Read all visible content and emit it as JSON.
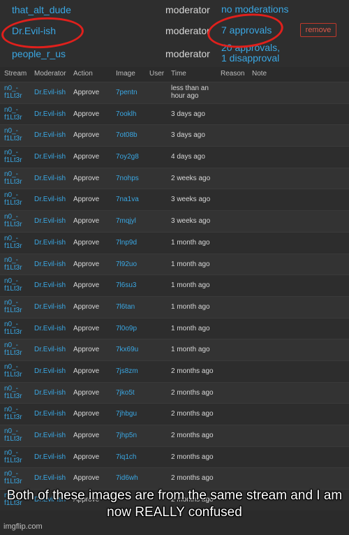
{
  "moderators": [
    {
      "name": "that_alt_dude",
      "role": "moderator",
      "count": "no moderations"
    },
    {
      "name": "Dr.Evil-ish",
      "role": "moderator",
      "count": "7 approvals"
    },
    {
      "name": "people_r_us",
      "role": "moderator",
      "count": "20 approvals,\n1 disapproval"
    }
  ],
  "remove_label": "remove",
  "headers": {
    "stream": "Stream",
    "moderator": "Moderator",
    "action": "Action",
    "image": "Image",
    "user": "User",
    "time": "Time",
    "reason": "Reason",
    "note": "Note"
  },
  "rows": [
    {
      "stream": "n0_-\nf1Lt3r",
      "moderator": "Dr.Evil-ish",
      "action": "Approve",
      "image": "7pentn",
      "time": "less than an\nhour ago"
    },
    {
      "stream": "n0_-\nf1Lt3r",
      "moderator": "Dr.Evil-ish",
      "action": "Approve",
      "image": "7ooklh",
      "time": "3 days ago"
    },
    {
      "stream": "n0_-\nf1Lt3r",
      "moderator": "Dr.Evil-ish",
      "action": "Approve",
      "image": "7ot08b",
      "time": "3 days ago"
    },
    {
      "stream": "n0_-\nf1Lt3r",
      "moderator": "Dr.Evil-ish",
      "action": "Approve",
      "image": "7oy2g8",
      "time": "4 days ago"
    },
    {
      "stream": "n0_-\nf1Lt3r",
      "moderator": "Dr.Evil-ish",
      "action": "Approve",
      "image": "7nohps",
      "time": "2 weeks ago"
    },
    {
      "stream": "n0_-\nf1Lt3r",
      "moderator": "Dr.Evil-ish",
      "action": "Approve",
      "image": "7na1va",
      "time": "3 weeks ago"
    },
    {
      "stream": "n0_-\nf1Lt3r",
      "moderator": "Dr.Evil-ish",
      "action": "Approve",
      "image": "7mqjyl",
      "time": "3 weeks ago"
    },
    {
      "stream": "n0_-\nf1Lt3r",
      "moderator": "Dr.Evil-ish",
      "action": "Approve",
      "image": "7lnp9d",
      "time": "1 month ago"
    },
    {
      "stream": "n0_-\nf1Lt3r",
      "moderator": "Dr.Evil-ish",
      "action": "Approve",
      "image": "7l92uo",
      "time": "1 month ago"
    },
    {
      "stream": "n0_-\nf1Lt3r",
      "moderator": "Dr.Evil-ish",
      "action": "Approve",
      "image": "7l6su3",
      "time": "1 month ago"
    },
    {
      "stream": "n0_-\nf1Lt3r",
      "moderator": "Dr.Evil-ish",
      "action": "Approve",
      "image": "7l6tan",
      "time": "1 month ago"
    },
    {
      "stream": "n0_-\nf1Lt3r",
      "moderator": "Dr.Evil-ish",
      "action": "Approve",
      "image": "7l0o9p",
      "time": "1 month ago"
    },
    {
      "stream": "n0_-\nf1Lt3r",
      "moderator": "Dr.Evil-ish",
      "action": "Approve",
      "image": "7kx69u",
      "time": "1 month ago"
    },
    {
      "stream": "n0_-\nf1Lt3r",
      "moderator": "Dr.Evil-ish",
      "action": "Approve",
      "image": "7js8zm",
      "time": "2 months ago"
    },
    {
      "stream": "n0_-\nf1Lt3r",
      "moderator": "Dr.Evil-ish",
      "action": "Approve",
      "image": "7jko5t",
      "time": "2 months ago"
    },
    {
      "stream": "n0_-\nf1Lt3r",
      "moderator": "Dr.Evil-ish",
      "action": "Approve",
      "image": "7jhbgu",
      "time": "2 months ago"
    },
    {
      "stream": "n0_-\nf1Lt3r",
      "moderator": "Dr.Evil-ish",
      "action": "Approve",
      "image": "7jhp5n",
      "time": "2 months ago"
    },
    {
      "stream": "n0_-\nf1Lt3r",
      "moderator": "Dr.Evil-ish",
      "action": "Approve",
      "image": "7iq1ch",
      "time": "2 months ago"
    },
    {
      "stream": "n0_-\nf1Lt3r",
      "moderator": "Dr.Evil-ish",
      "action": "Approve",
      "image": "7id6wh",
      "time": "2 months ago"
    },
    {
      "stream": "n0_-\nf1Lt3r",
      "moderator": "Dr.Evil-ish",
      "action": "Approve",
      "image": "",
      "time": "2 months ago"
    }
  ],
  "caption": "Both of these images are from the same stream and I am now REALLY confused",
  "watermark": "imgflip.com",
  "colors": {
    "link": "#3aa7e3",
    "circle": "#e0201c",
    "remove": "#e05a4a"
  }
}
